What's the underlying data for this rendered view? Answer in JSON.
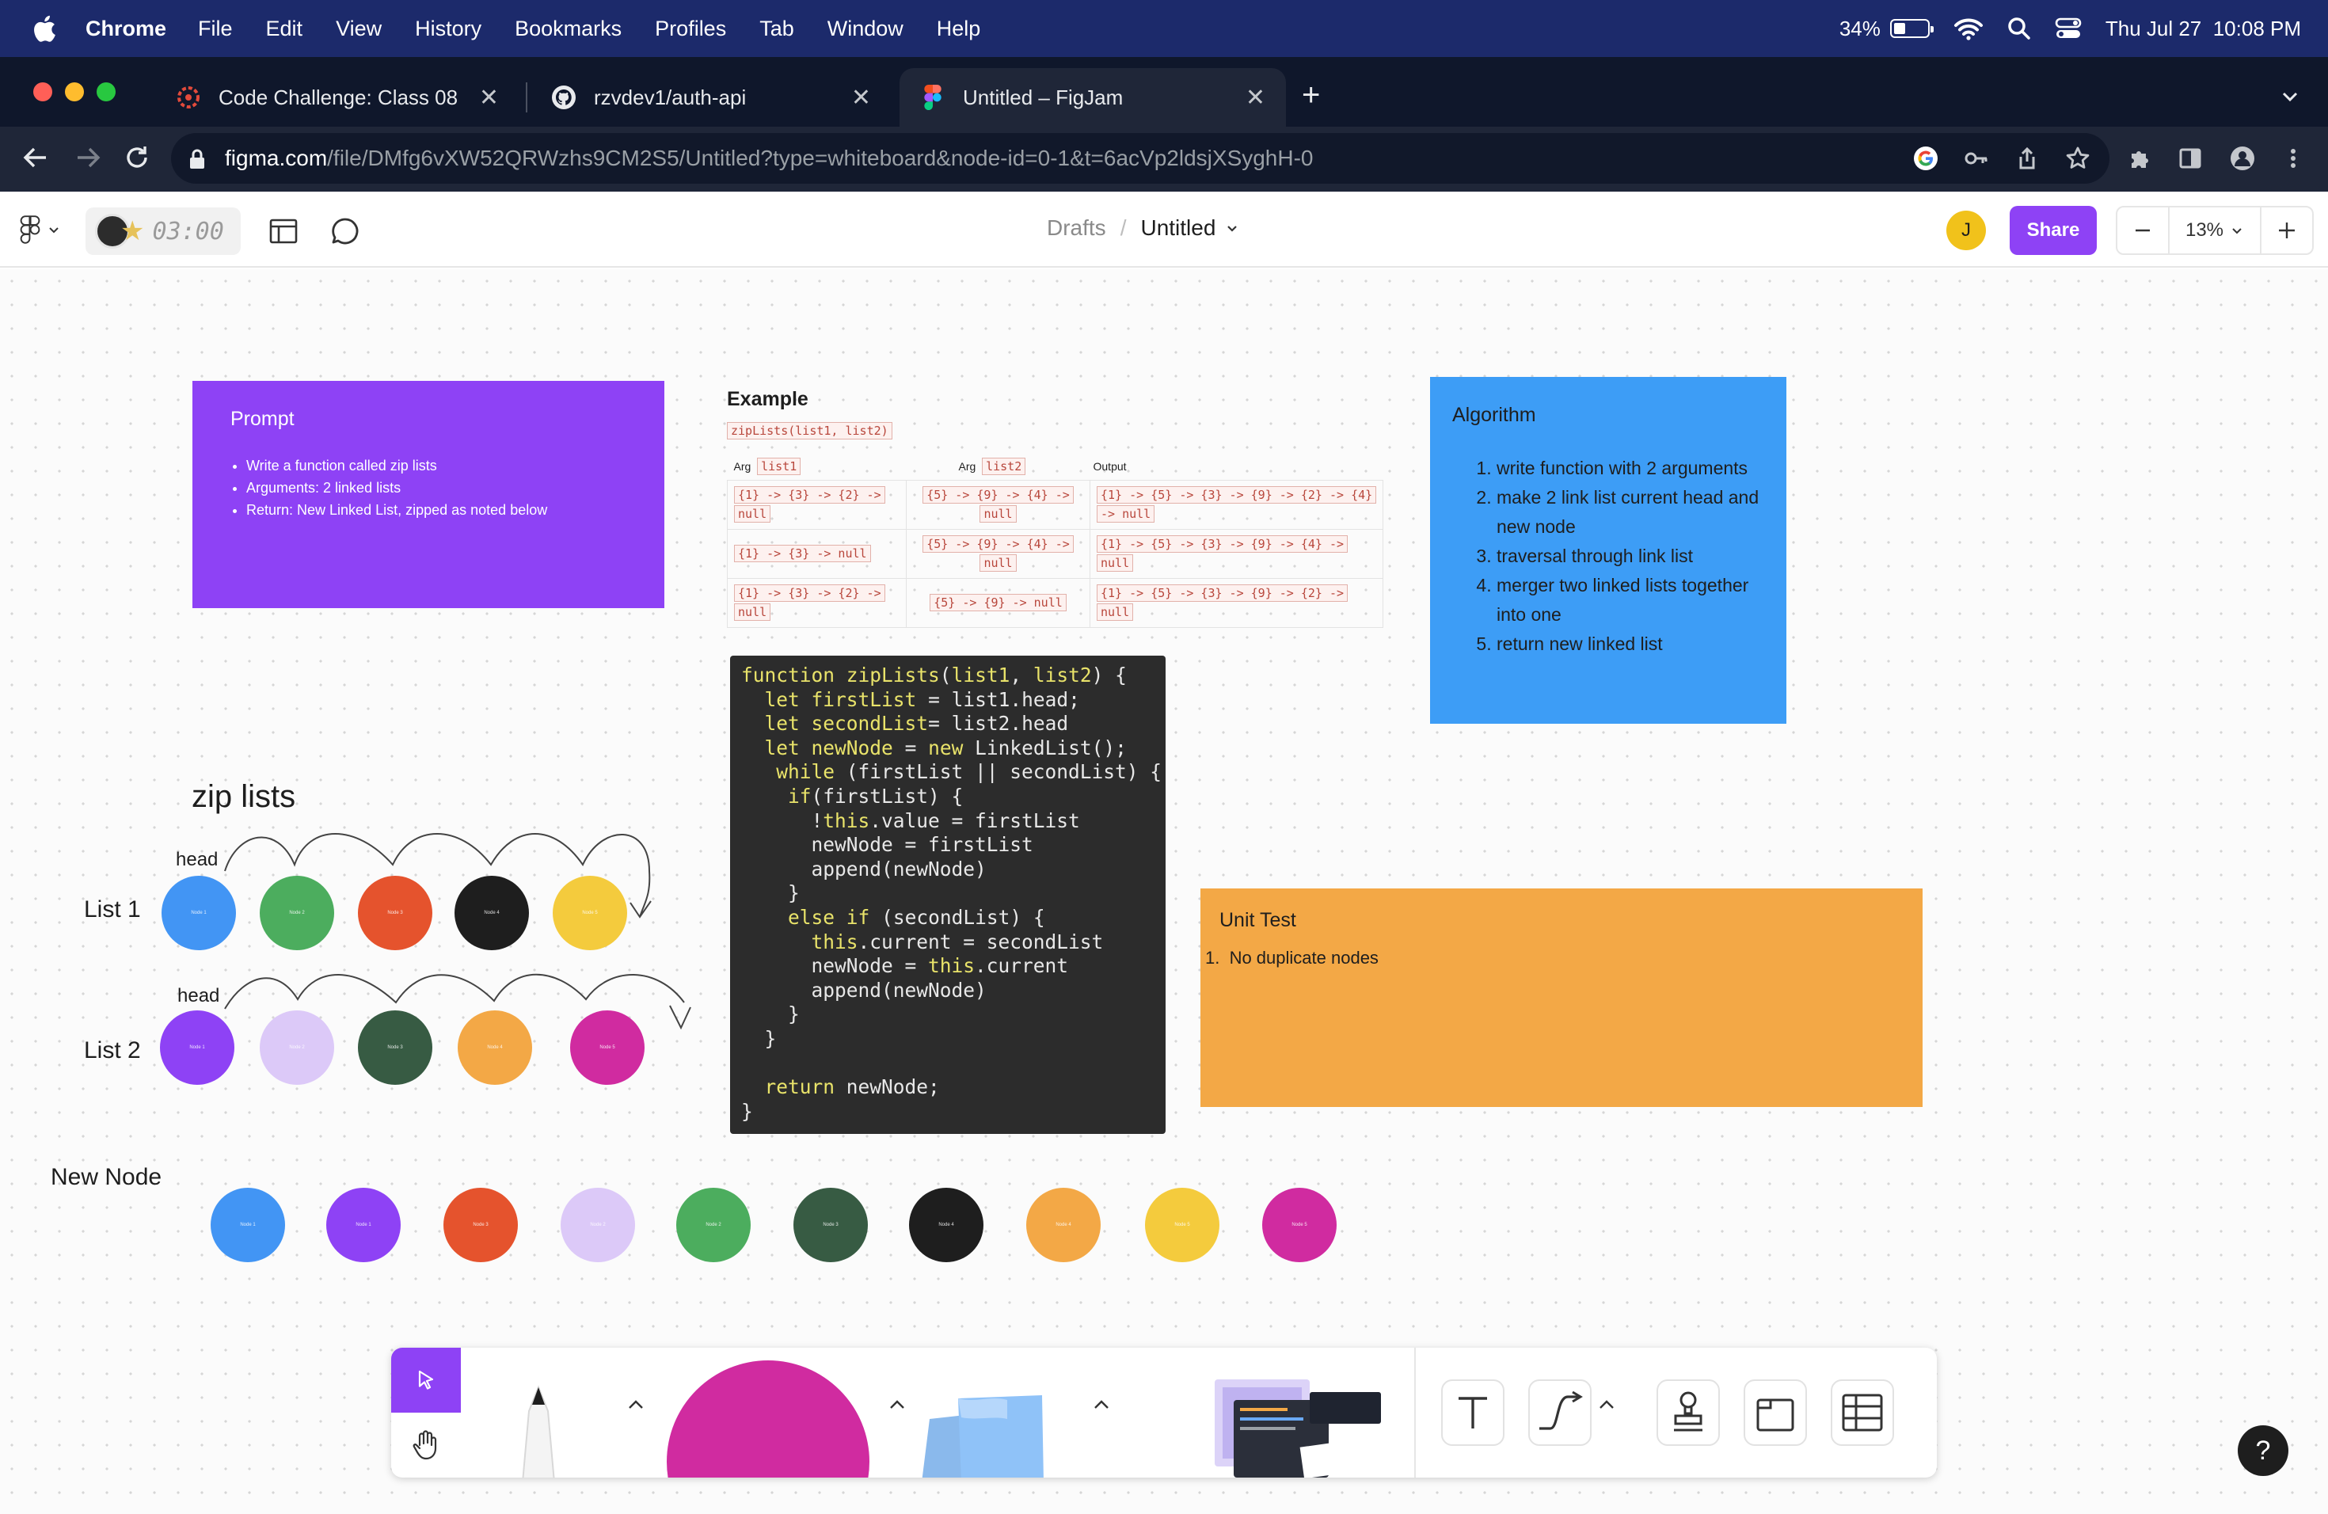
{
  "menubar": {
    "app": "Chrome",
    "items": [
      "File",
      "Edit",
      "View",
      "History",
      "Bookmarks",
      "Profiles",
      "Tab",
      "Window",
      "Help"
    ],
    "battery": "34%",
    "battery_level": 0.34,
    "clock": "Thu Jul 27  10:08 PM"
  },
  "browser": {
    "tabs": [
      {
        "label": "Code Challenge: Class 08",
        "icon": "codefellows-icon",
        "active": false
      },
      {
        "label": "rzvdev1/auth-api",
        "icon": "github-icon",
        "active": false
      },
      {
        "label": "Untitled – FigJam",
        "icon": "figma-icon",
        "active": true
      }
    ],
    "url_host": "figma.com",
    "url_path": "/file/DMfg6vXW52QRWzhs9CM2S5/Untitled?type=whiteboard&node-id=0-1&t=6acVp2ldsjXSyghH-0"
  },
  "figjam": {
    "timer": "03:00",
    "breadcrumb_parent": "Drafts",
    "breadcrumb_sep": "/",
    "file_title": "Untitled",
    "user_initial": "J",
    "share_label": "Share",
    "zoom_minus": "—",
    "zoom": "13%",
    "zoom_plus": "+",
    "help": "?",
    "accent": "#8e42f5"
  },
  "board": {
    "prompt": {
      "title": "Prompt",
      "items": [
        "Write a function called zip lists",
        "Arguments: 2 linked lists",
        "Return: New Linked List, zipped as noted below"
      ]
    },
    "example": {
      "title": "Example",
      "signature": "zipLists(list1, list2)",
      "arg_label": "Arg",
      "col1": "list1",
      "col2": "list2",
      "col3": "Output",
      "rows": [
        {
          "list1": [
            "{1} -> {3} -> {2} ->",
            "null"
          ],
          "list2": [
            "{5} -> {9} -> {4} ->",
            "null"
          ],
          "output": [
            "{1} -> {5} -> {3} -> {9} -> {2} -> {4}",
            "-> null"
          ]
        },
        {
          "list1": [
            "{1} -> {3} -> null"
          ],
          "list2": [
            "{5} -> {9} -> {4} ->",
            "null"
          ],
          "output": [
            "{1} -> {5} -> {3} -> {9} -> {4} ->",
            "null"
          ]
        },
        {
          "list1": [
            "{1} -> {3} -> {2} ->",
            "null"
          ],
          "list2": [
            "{5} -> {9} -> null"
          ],
          "output": [
            "{1} -> {5} -> {3} -> {9} -> {2} ->",
            "null"
          ]
        }
      ]
    },
    "code": "function zipLists(list1, list2) {\n  let firstList = list1.head;\n  let secondList= list2.head\n  let newNode = new LinkedList();\n   while (firstList || secondList) {\n    if(firstList) {\n      !this.value = firstList\n      newNode = firstList\n      append(newNode)\n    }\n    else if (secondList) {\n      this.current = secondList\n      newNode = this.current\n      append(newNode)\n    }\n  }\n\n  return newNode;\n}",
    "algorithm": {
      "title": "Algorithm",
      "steps": [
        "write function with 2 arguments",
        "make 2 link list current head and new node",
        "traversal through link list",
        "merger two linked lists together into one",
        "return new linked list"
      ]
    },
    "unit_test": {
      "title": "Unit Test",
      "items": [
        "1.  No duplicate nodes"
      ]
    },
    "zip_title": "zip lists",
    "head_label": "head",
    "list1": {
      "label": "List 1",
      "nodes": [
        {
          "label": "Node 1",
          "color": "#4295f4"
        },
        {
          "label": "Node 2",
          "color": "#4cad5e"
        },
        {
          "label": "Node 3",
          "color": "#e5532d"
        },
        {
          "label": "Node 4",
          "color": "#1e1e1e"
        },
        {
          "label": "Node 5",
          "color": "#f4cb3d"
        }
      ]
    },
    "list2": {
      "label": "List 2",
      "nodes": [
        {
          "label": "Node 1",
          "color": "#8e42f5"
        },
        {
          "label": "Node 2",
          "color": "#dcc9f8"
        },
        {
          "label": "Node 3",
          "color": "#375b43"
        },
        {
          "label": "Node 4",
          "color": "#f3a846"
        },
        {
          "label": "Node 5",
          "color": "#d02ba0"
        }
      ]
    },
    "new_node": {
      "label": "New Node",
      "nodes": [
        {
          "label": "Node 1",
          "color": "#4295f4"
        },
        {
          "label": "Node 1",
          "color": "#8e42f5"
        },
        {
          "label": "Node 3",
          "color": "#e5532d"
        },
        {
          "label": "Node 2",
          "color": "#dcc9f8"
        },
        {
          "label": "Node 2",
          "color": "#4cad5e"
        },
        {
          "label": "Node 3",
          "color": "#375b43"
        },
        {
          "label": "Node 4",
          "color": "#1e1e1e"
        },
        {
          "label": "Node 4",
          "color": "#f3a846"
        },
        {
          "label": "Node 5",
          "color": "#f4cb3d"
        },
        {
          "label": "Node 5",
          "color": "#d02ba0"
        }
      ]
    }
  },
  "dock": {
    "tools": [
      "move-tool",
      "hand-tool",
      "marker-tool",
      "shape-tool",
      "sticky-note-tool",
      "templates-tool",
      "text-tool",
      "connector-tool",
      "stamp-tool",
      "section-tool",
      "table-tool"
    ],
    "shape_color": "#d02ba0",
    "sticky_color": "#8fc2f8"
  }
}
